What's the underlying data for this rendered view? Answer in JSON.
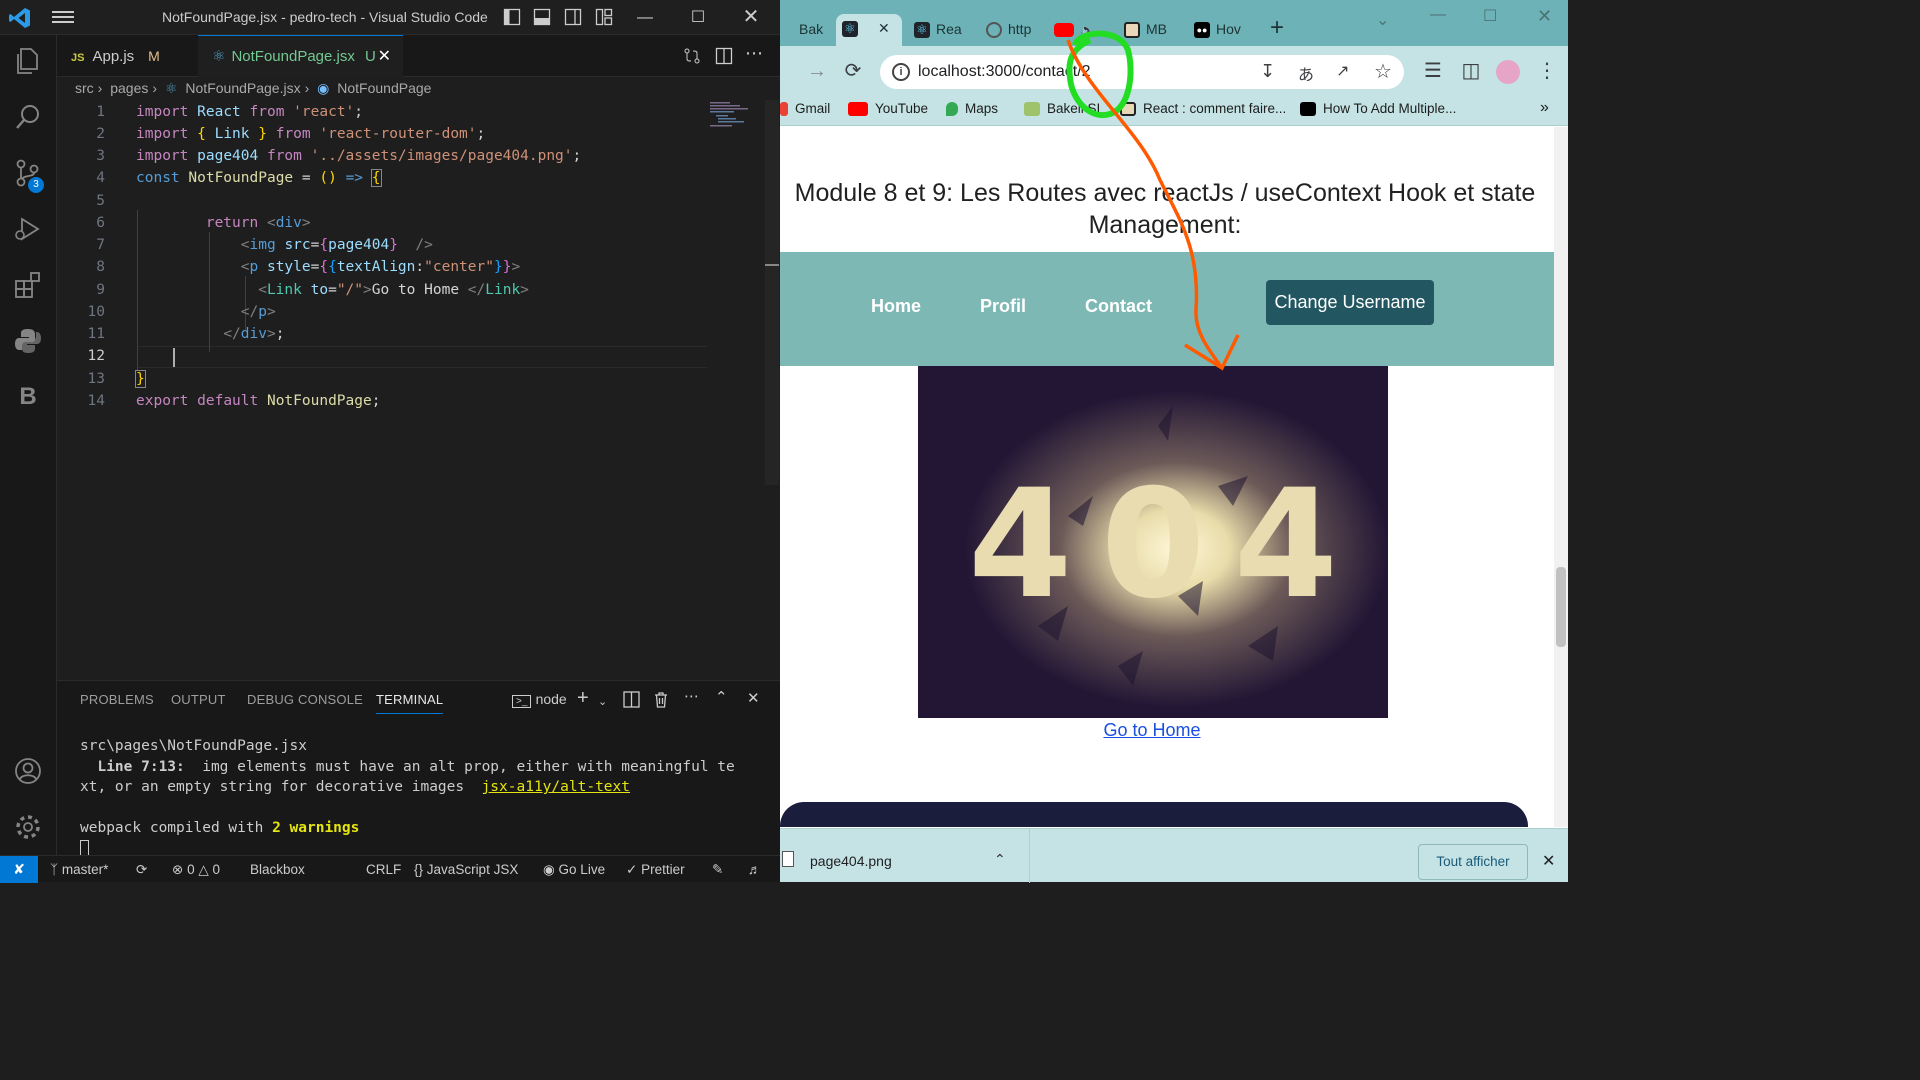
{
  "vscode": {
    "window_title": "NotFoundPage.jsx - pedro-tech - Visual Studio Code",
    "tabs": [
      {
        "icon": "JS",
        "label": "App.js",
        "status": "M"
      },
      {
        "label": "NotFoundPage.jsx",
        "status": "U"
      }
    ],
    "breadcrumb": [
      "src",
      "pages",
      "NotFoundPage.jsx",
      "NotFoundPage"
    ],
    "source_control_badge": "3",
    "line_numbers": [
      "1",
      "2",
      "3",
      "4",
      "5",
      "6",
      "7",
      "8",
      "9",
      "10",
      "11",
      "12",
      "13",
      "14"
    ],
    "code": {
      "l1_import": "import",
      "l1_react": "React",
      "l1_from": "from",
      "l1_str": "'react'",
      "l2_import": "import",
      "l2_link": "Link",
      "l2_from": "from",
      "l2_str": "'react-router-dom'",
      "l3_import": "import",
      "l3_page": "page404",
      "l3_from": "from",
      "l3_str": "'../assets/images/page404.png'",
      "l4_const": "const",
      "l4_name": "NotFoundPage",
      "l4_arrow": "=>",
      "l6_return": "return",
      "l6_div": "div",
      "l7_img": "img",
      "l7_src": "src",
      "l7_val": "page404",
      "l8_p": "p",
      "l8_style": "style",
      "l8_key": "textAlign",
      "l8_val": "\"center\"",
      "l9_link": "Link",
      "l9_to": "to",
      "l9_val": "\"/\"",
      "l9_text": "Go to Home ",
      "l9_close": "Link",
      "l10_p": "p",
      "l11_div": "div",
      "l14_export": "export",
      "l14_default": "default",
      "l14_name": "NotFoundPage"
    },
    "panel_tabs": [
      "PROBLEMS",
      "OUTPUT",
      "DEBUG CONSOLE",
      "TERMINAL"
    ],
    "terminal_shell": "node",
    "terminal": {
      "line1": "src\\pages\\NotFoundPage.jsx",
      "line2_pos": "  Line 7:13:",
      "line2_msg": "  img elements must have an alt prop, either with meaningful te",
      "line3_msg": "xt, or an empty string for decorative images  ",
      "line3_rule": "jsx-a11y/alt-text",
      "line5_a": "webpack compiled with ",
      "line5_b": "2 warnings"
    },
    "status": {
      "branch": "master*",
      "errors": "0",
      "warnings": "0",
      "blackbox": "Blackbox",
      "eol": "CRLF",
      "language": "JavaScript JSX",
      "golive": "Go Live",
      "prettier": "Prettier"
    }
  },
  "chrome": {
    "tabs": [
      "Bak",
      "Rea",
      "http",
      "MB",
      "Hov"
    ],
    "url": "localhost:3000/contact/2",
    "bookmarks": [
      "Gmail",
      "YouTube",
      "Maps",
      "Bakeli SI",
      "React : comment faire...",
      "How To Add Multiple..."
    ],
    "page": {
      "heading": "Module 8 et 9: Les Routes avec reactJs / useContext Hook et state Management:",
      "nav": [
        "Home",
        "Profil",
        "Contact"
      ],
      "button": "Change Username",
      "image_text": "404",
      "link": "Go to Home"
    },
    "download": {
      "file": "page404.png",
      "show_all": "Tout afficher"
    }
  }
}
